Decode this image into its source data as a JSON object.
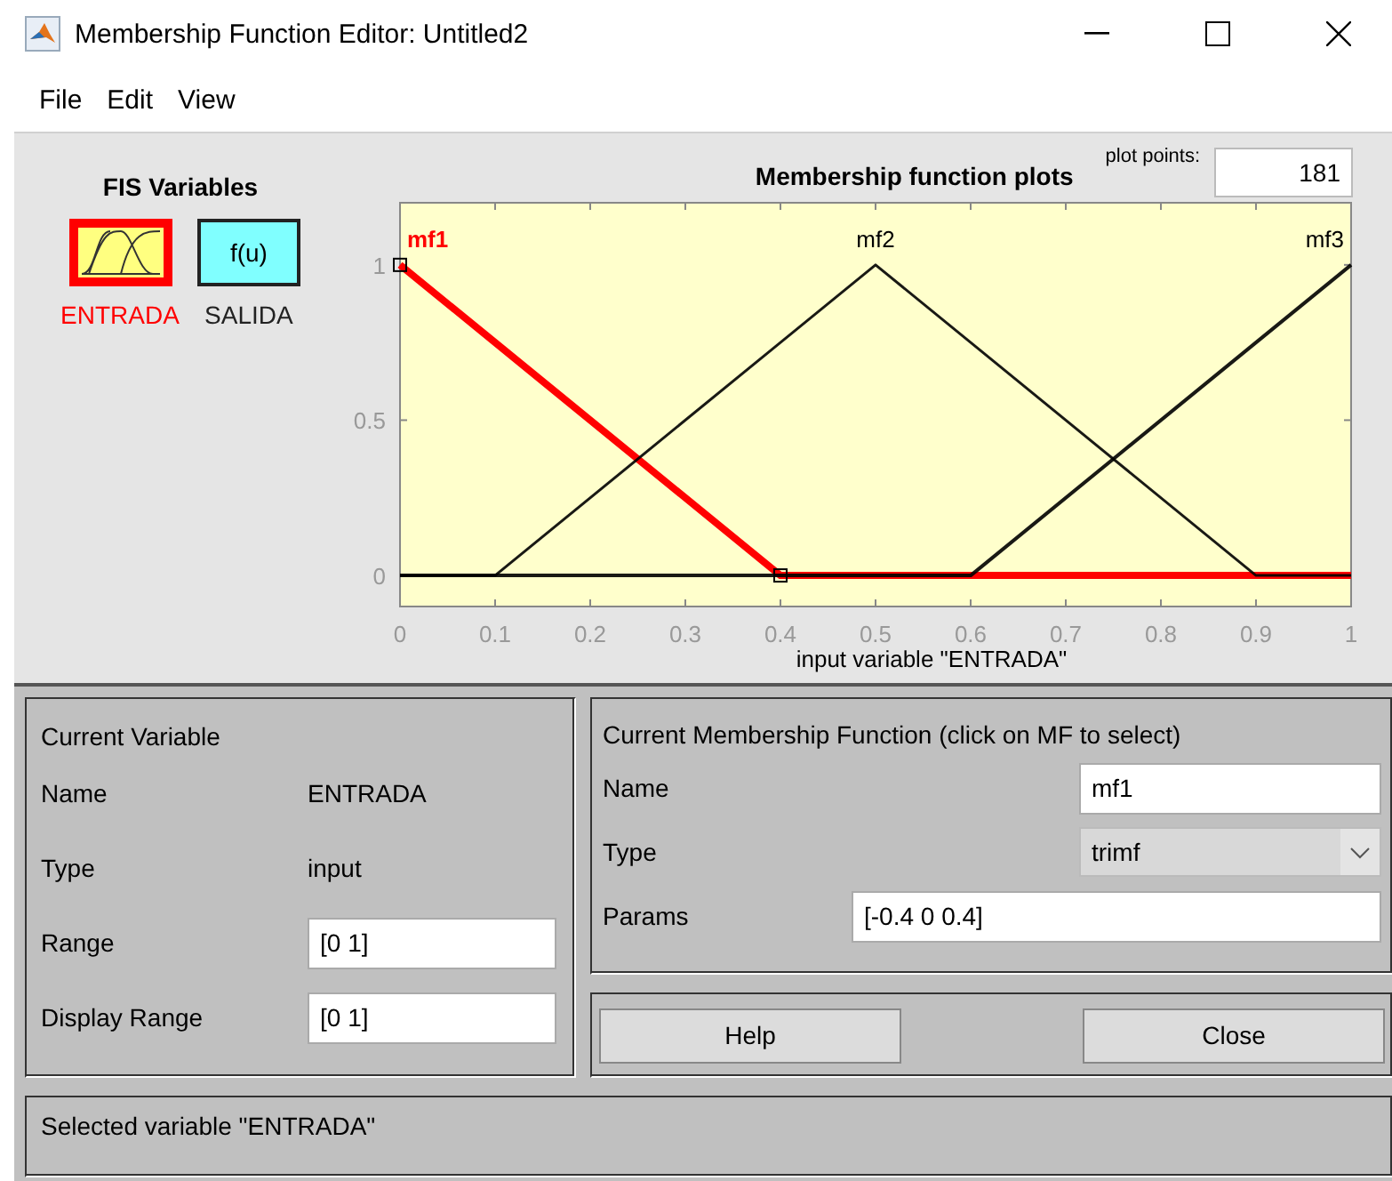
{
  "window": {
    "title": "Membership Function Editor: Untitled2"
  },
  "menu": [
    "File",
    "Edit",
    "View"
  ],
  "fis_variables": {
    "title": "FIS Variables",
    "items": [
      {
        "label": "ENTRADA",
        "kind": "input",
        "selected": true
      },
      {
        "label": "SALIDA",
        "kind": "output",
        "icon_text": "f(u)",
        "selected": false
      }
    ]
  },
  "plot": {
    "title": "Membership function plots",
    "plot_points_label": "plot points:",
    "plot_points": "181",
    "chart_data": {
      "type": "line",
      "xlabel": "input variable \"ENTRADA\"",
      "x": [
        0,
        0.1,
        0.4,
        0.5,
        0.6,
        0.9,
        1
      ],
      "xlim": [
        0,
        1
      ],
      "ylim": [
        -0.1,
        1.2
      ],
      "xticks": [
        0,
        0.1,
        0.2,
        0.3,
        0.4,
        0.5,
        0.6,
        0.7,
        0.8,
        0.9,
        1
      ],
      "yticks": [
        0,
        0.5,
        1
      ],
      "series": [
        {
          "name": "mf1",
          "color": "#ff0000",
          "values": [
            1,
            0.75,
            0,
            0,
            0,
            0,
            0
          ]
        },
        {
          "name": "mf2",
          "color": "#000000",
          "values": [
            0,
            0,
            0.75,
            1,
            0.75,
            0,
            0
          ]
        },
        {
          "name": "mf3",
          "color": "#000000",
          "values": [
            0,
            0,
            0,
            0,
            0,
            0.75,
            1
          ]
        }
      ]
    },
    "curves": [
      {
        "selected": true
      },
      {
        "selected": false
      },
      {
        "selected": false
      }
    ]
  },
  "current_variable": {
    "title": "Current Variable",
    "name_label": "Name",
    "name": "ENTRADA",
    "type_label": "Type",
    "type": "input",
    "range_label": "Range",
    "range": "[0 1]",
    "display_range_label": "Display Range",
    "display_range": "[0 1]"
  },
  "current_mf": {
    "title": "Current Membership Function (click on MF to select)",
    "name_label": "Name",
    "name": "mf1",
    "type_label": "Type",
    "type": "trimf",
    "params_label": "Params",
    "params": "[-0.4 0 0.4]"
  },
  "buttons": [
    "Help",
    "Close"
  ],
  "status_bar": "Selected variable \"ENTRADA\""
}
